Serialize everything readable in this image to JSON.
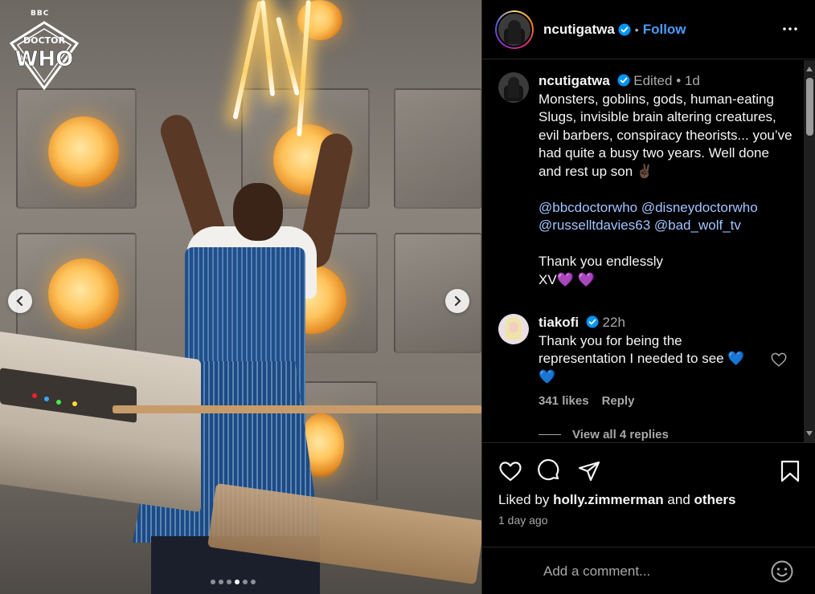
{
  "post": {
    "username": "ncutigatwa",
    "follow_label": "Follow",
    "separator": "•"
  },
  "caption": {
    "username": "ncutigatwa",
    "edited_label": "Edited",
    "dot": "•",
    "time": "1d",
    "lines": [
      "Monsters, goblins, gods, human-eating Slugs, invisible brain altering creatures, evil barbers, conspiracy theorists... you’ve had quite a busy two years. Well done and rest up son ✌🏿"
    ],
    "mentions_1": [
      "@bbcdoctorwho",
      "@disneydoctorwho"
    ],
    "mentions_2": [
      "@russelltdavies63",
      "@bad_wolf_tv"
    ],
    "thanks": "Thank you endlessly",
    "signoff": "XV",
    "signoff_emoji": "💜 💜"
  },
  "comment": {
    "username": "tiakofi",
    "time": "22h",
    "text": "Thank you for being the representation I needed to see",
    "emoji_1": "💙",
    "emoji_2": "💙",
    "likes": "341 likes",
    "reply_label": "Reply",
    "view_replies": "View all 4 replies"
  },
  "footer": {
    "liked_by_prefix": "Liked by",
    "liked_by_user": "holly.zimmerman",
    "liked_by_and": "and",
    "liked_by_others": "others",
    "time_ago": "1 day ago",
    "comment_placeholder": "Add a comment..."
  },
  "media": {
    "logo_bbc": "BBC",
    "logo_doctor": "DOCTOR",
    "logo_who": "WHO",
    "carousel_total": 6,
    "carousel_active": 3
  },
  "icons": {
    "more": "more-horizontal-icon",
    "verified": "verified-badge-icon",
    "like": "heart-outline-icon",
    "comment": "speech-bubble-icon",
    "share": "paper-plane-icon",
    "save": "bookmark-icon",
    "emoji": "smiley-icon",
    "prev": "chevron-left-icon",
    "next": "chevron-right-icon"
  },
  "colors": {
    "accent": "#4c9bff",
    "mention": "#a2c4ff",
    "muted": "#a8a8a8",
    "background": "#000000"
  }
}
